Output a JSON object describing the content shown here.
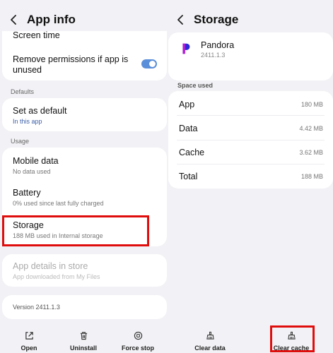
{
  "left": {
    "header": {
      "title": "App info"
    },
    "rows": {
      "screen_time": "Screen time",
      "remove_permissions": "Remove permissions if app is unused"
    },
    "sections": {
      "defaults": "Defaults",
      "usage": "Usage"
    },
    "set_default": {
      "title": "Set as default",
      "sub": "In this app"
    },
    "mobile_data": {
      "title": "Mobile data",
      "sub": "No data used"
    },
    "battery": {
      "title": "Battery",
      "sub": "0% used since last fully charged"
    },
    "storage": {
      "title": "Storage",
      "sub": "188 MB used in Internal storage"
    },
    "app_details": {
      "title": "App details in store",
      "sub": "App downloaded from My Files"
    },
    "version": "Version 2411.1.3",
    "toggle_on": true,
    "bottom": {
      "open": "Open",
      "uninstall": "Uninstall",
      "force_stop": "Force stop"
    }
  },
  "right": {
    "header": {
      "title": "Storage"
    },
    "app": {
      "name": "Pandora",
      "version": "2411.1.3"
    },
    "section": "Space used",
    "items": [
      {
        "label": "App",
        "value": "180 MB"
      },
      {
        "label": "Data",
        "value": "4.42 MB"
      },
      {
        "label": "Cache",
        "value": "3.62 MB"
      },
      {
        "label": "Total",
        "value": "188 MB"
      }
    ],
    "bottom": {
      "clear_data": "Clear data",
      "clear_cache": "Clear cache"
    }
  },
  "colors": {
    "accent": "#5b8fd9",
    "highlight": "#e00d0d",
    "pandora": "#2b2ad6"
  }
}
